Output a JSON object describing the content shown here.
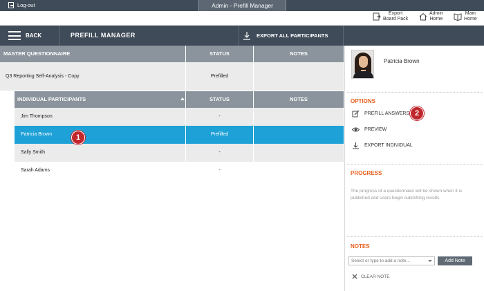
{
  "topbar": {
    "logout_label": "Log-out",
    "window_title": "Admin - Prefill Manager"
  },
  "toolbar": {
    "export_board_pack": [
      "Export",
      "Board Pack"
    ],
    "admin_home": [
      "Admin",
      "Home"
    ],
    "main_home": [
      "Main",
      "Home"
    ]
  },
  "header": {
    "back_label": "BACK",
    "title": "PREFILL MANAGER",
    "export_all_label": "EXPORT ALL PARTICIPANTS"
  },
  "master_questionnaire": {
    "header": "MASTER QUESTIONNAIRE",
    "status_header": "STATUS",
    "notes_header": "NOTES",
    "row": {
      "name": "Q3 Reporting Self-Analysis - Copy",
      "status": "Prefilled",
      "notes": ""
    }
  },
  "participants": {
    "header": "INDIVIDUAL PARTICIPANTS",
    "status_header": "STATUS",
    "notes_header": "NOTES",
    "rows": [
      {
        "name": "Jim Thompson",
        "status": "-",
        "notes": ""
      },
      {
        "name": "Patricia Brown",
        "status": "Prefilled",
        "notes": ""
      },
      {
        "name": "Sally Smith",
        "status": "-",
        "notes": ""
      },
      {
        "name": "Sarah Adams",
        "status": "-",
        "notes": ""
      }
    ],
    "selected_index": 1
  },
  "badges": [
    "1",
    "2"
  ],
  "right_panel": {
    "participant_name": "Patricia Brown",
    "options_title": "OPTIONS",
    "options": [
      {
        "label": "PREFILL ANSWERS",
        "icon": "edit-icon"
      },
      {
        "label": "PREVIEW",
        "icon": "eye-icon"
      },
      {
        "label": "EXPORT INDIVIDUAL",
        "icon": "download-icon"
      }
    ],
    "progress_title": "PROGRESS",
    "progress_text": "The progress of a questionnaire will be shown when it is published and users begin submitting results.",
    "notes_title": "NOTES",
    "note_placeholder": "Select or type to add a note...",
    "add_note_label": "Add Note",
    "clear_note_label": "CLEAR NOTE"
  },
  "colors": {
    "dark_bar": "#3f4b58",
    "table_header": "#8b949c",
    "selected_row": "#1da1d6",
    "accent_orange": "#e8601c",
    "badge_red": "#c0272d"
  }
}
